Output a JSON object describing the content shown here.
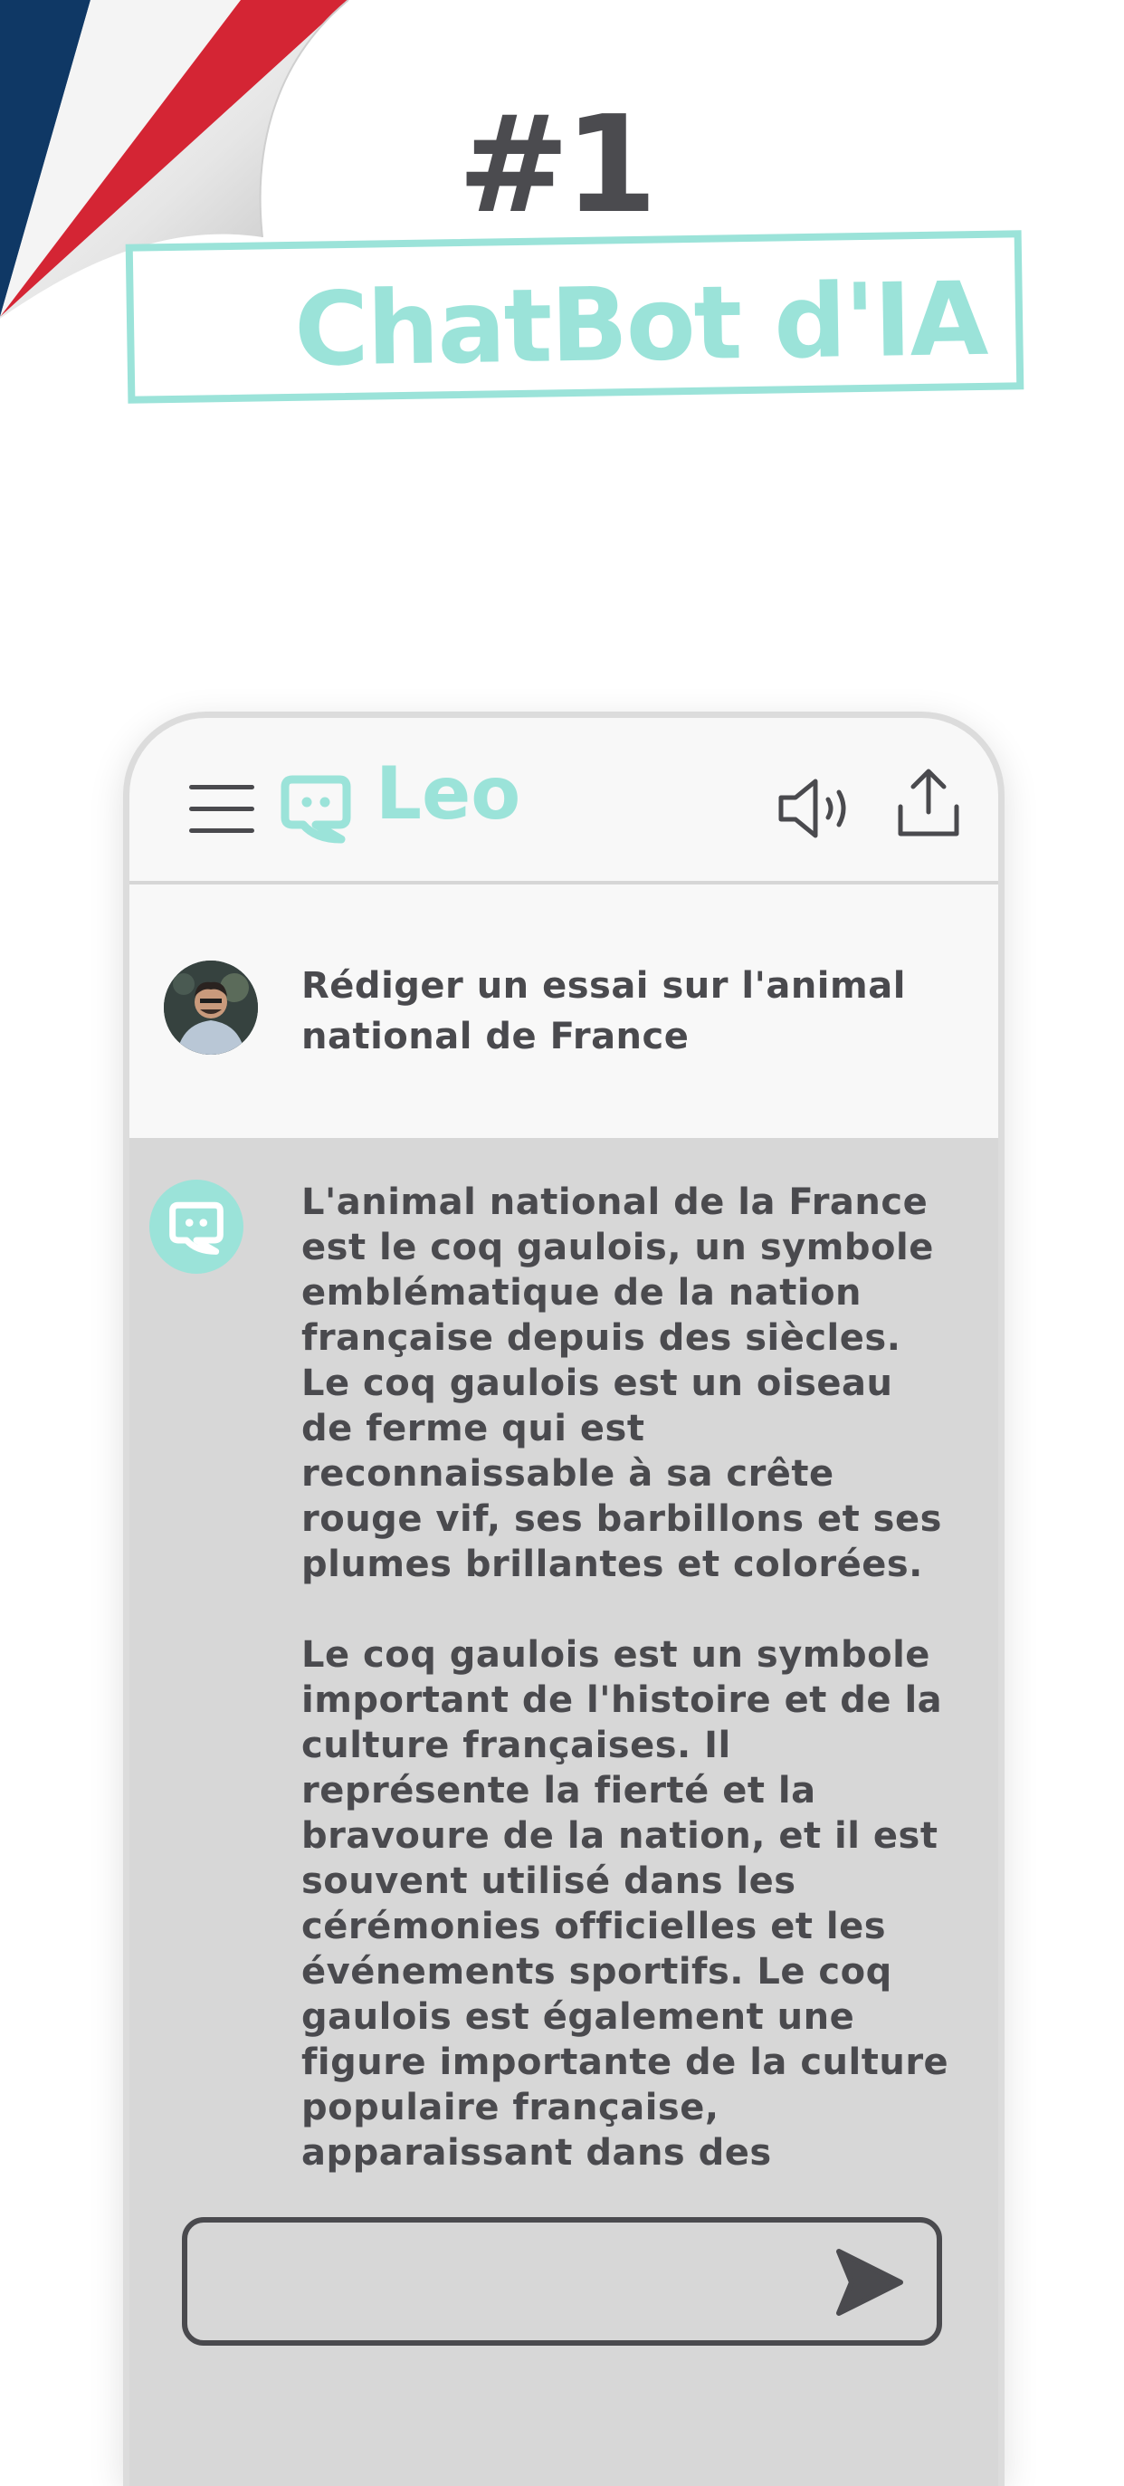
{
  "promo": {
    "rank": "#1",
    "headline": "ChatBot d'IA"
  },
  "colors": {
    "accent": "#9be3d9",
    "text": "#4a4a4e",
    "flag_blue": "#0f3865",
    "flag_red": "#d42534"
  },
  "app": {
    "brand": "Leo",
    "icons": [
      "menu-icon",
      "chat-bubble-icon",
      "speaker-icon",
      "share-icon",
      "send-icon"
    ]
  },
  "conversation": {
    "user_message": "Rédiger un essai sur l'animal national de France",
    "bot_paragraph_1": "L'animal national de la France est le coq gaulois, un symbole emblématique de la nation française depuis des siècles. Le coq gaulois est un oiseau de ferme qui est reconnaissable à sa crête rouge vif, ses barbillons et ses plumes brillantes et colorées.",
    "bot_paragraph_2": "Le coq gaulois est un symbole important de l'histoire et de la culture françaises. Il représente la fierté et la bravoure de la nation, et il est souvent utilisé dans les cérémonies officielles et les événements sportifs. Le coq gaulois est également une figure importante de la culture populaire française, apparaissant dans des"
  },
  "input": {
    "value": ""
  }
}
